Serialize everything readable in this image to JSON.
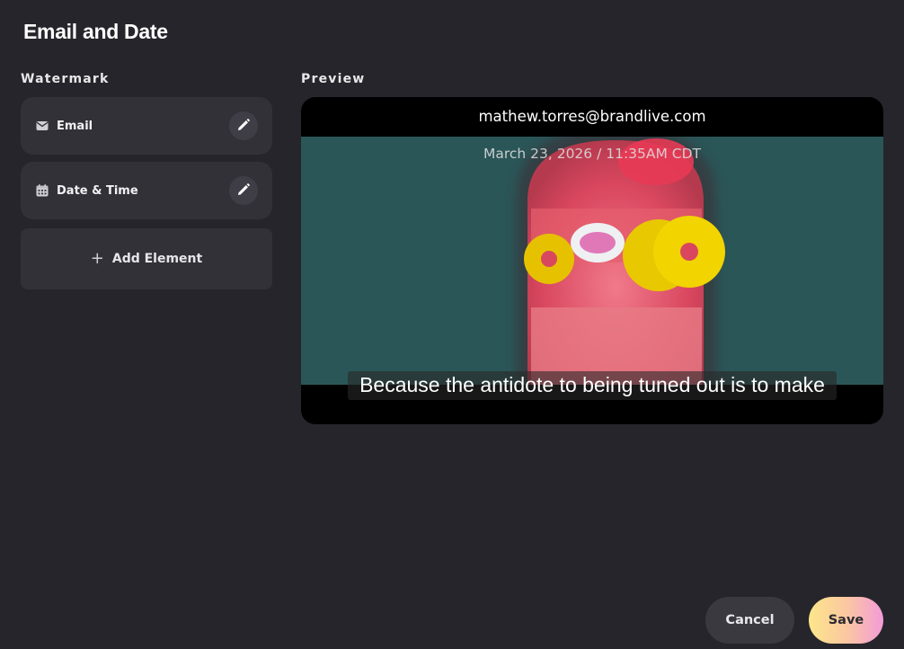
{
  "page": {
    "title": "Email and Date"
  },
  "watermark": {
    "section_label": "Watermark",
    "elements": [
      {
        "label": "Email",
        "icon": "envelope-icon"
      },
      {
        "label": "Date & Time",
        "icon": "calendar-icon"
      }
    ],
    "add_label": "Add Element"
  },
  "preview": {
    "section_label": "Preview",
    "email_text": "mathew.torres@brandlive.com",
    "date_text": "March 23, 2026 / 11:35AM CDT",
    "caption": "Because the antidote to being tuned out is to make"
  },
  "actions": {
    "cancel_label": "Cancel",
    "save_label": "Save"
  },
  "colors": {
    "background": "#26252b",
    "card": "#323138",
    "save_gradient_start": "#fde68a",
    "save_gradient_end": "#f39bd8"
  }
}
